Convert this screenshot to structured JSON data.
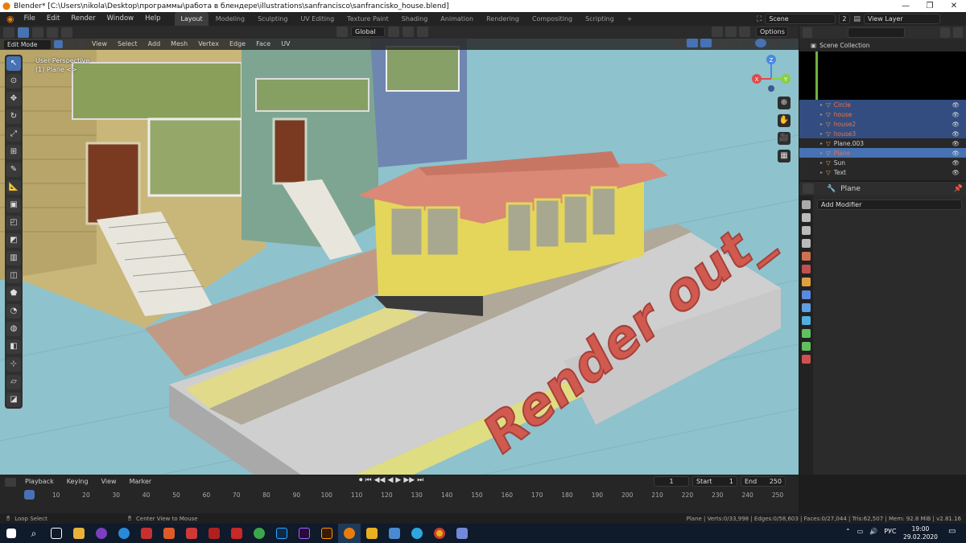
{
  "titlebar": {
    "title": "Blender* [C:\\Users\\nikola\\Desktop\\программы\\работа в блендере\\illustrations\\sanfrancisco\\sanfrancisko_house.blend]",
    "min": "—",
    "max": "❐",
    "close": "✕"
  },
  "menus": [
    "File",
    "Edit",
    "Render",
    "Window",
    "Help"
  ],
  "workspaces": [
    "Layout",
    "Modeling",
    "Sculpting",
    "UV Editing",
    "Texture Paint",
    "Shading",
    "Animation",
    "Rendering",
    "Compositing",
    "Scripting"
  ],
  "workspace_add": "+",
  "scene": {
    "label": "Scene",
    "users": "2",
    "view_layer": "View Layer"
  },
  "vp_header": {
    "orientation": "Global",
    "options": "Options"
  },
  "vp_header2": {
    "mode": "Edit Mode",
    "items": [
      "View",
      "Select",
      "Add",
      "Mesh",
      "Vertex",
      "Edge",
      "Face",
      "UV"
    ]
  },
  "overlay_text": {
    "line1": "User Perspective",
    "line2": "(1) Plane <>"
  },
  "scene_text": "Render out_",
  "gizmo": {
    "z": "Z",
    "x": "X",
    "y": "Y"
  },
  "outliner": {
    "title": "Scene Collection",
    "items": [
      {
        "name": "Circle",
        "color": "#e8734a",
        "selected": true
      },
      {
        "name": "house",
        "color": "#e8734a",
        "selected": true
      },
      {
        "name": "house2",
        "color": "#e8734a",
        "selected": true
      },
      {
        "name": "house3",
        "color": "#e8734a",
        "selected": true
      },
      {
        "name": "Plane.003",
        "color": "#d0d0d0",
        "selected": false
      },
      {
        "name": "Plane",
        "color": "#e8734a",
        "selected": true,
        "active": true
      },
      {
        "name": "Sun",
        "color": "#d0d0d0",
        "selected": false
      },
      {
        "name": "Text",
        "color": "#d0d0d0",
        "selected": false
      }
    ]
  },
  "properties": {
    "object": "Plane",
    "add_modifier": "Add Modifier"
  },
  "timeline": {
    "playback": "Playback",
    "keying": "Keying",
    "view": "View",
    "marker": "Marker",
    "current": "1",
    "start_label": "Start",
    "start": "1",
    "end_label": "End",
    "end": "250",
    "ticks": [
      "1",
      "10",
      "20",
      "30",
      "40",
      "50",
      "60",
      "70",
      "80",
      "90",
      "100",
      "110",
      "120",
      "130",
      "140",
      "150",
      "160",
      "170",
      "180",
      "190",
      "200",
      "210",
      "220",
      "230",
      "240",
      "250"
    ]
  },
  "statusbar": {
    "left1": "Loop Select",
    "left2": "Center View to Mouse",
    "stats": "Plane | Verts:0/33,998 | Edges:0/58,603 | Faces:0/27,044 | Tris:62,507 | Mem: 92.8 MiB | v2.81.16"
  },
  "taskbar": {
    "lang": "РУС",
    "time": "19:00",
    "date": "29.02.2020"
  },
  "colors": {
    "accent": "#4772b3",
    "outliner_sel": "#334d80",
    "text_red": "#d05a50"
  }
}
